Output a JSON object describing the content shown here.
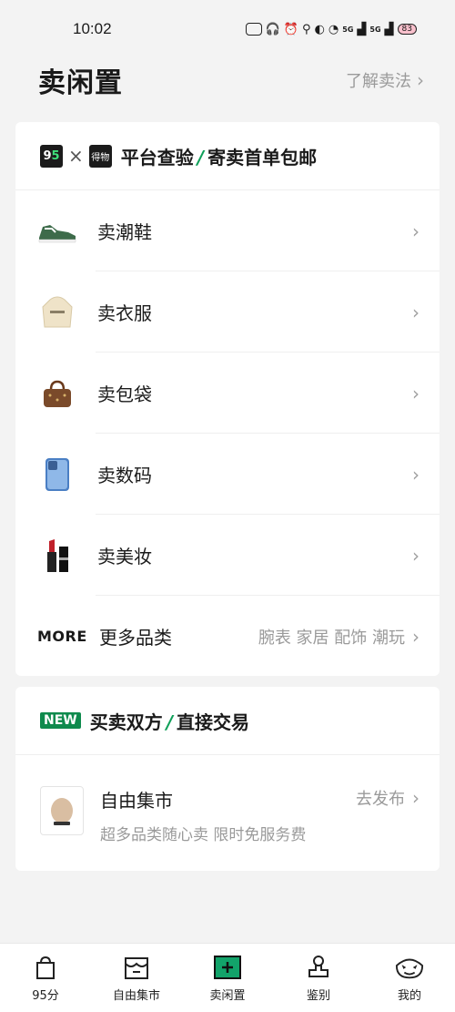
{
  "status": {
    "time": "10:02",
    "battery": "83",
    "signal1": "5G",
    "signal2": "5G"
  },
  "header": {
    "title": "卖闲置",
    "learn_label": "了解卖法"
  },
  "card1": {
    "logo95_a": "9",
    "logo95_b": "5",
    "logo_cross": "×",
    "logo_dw": "得物",
    "headline_a": "平台查验",
    "slash": "/",
    "headline_b": "寄卖首单包邮",
    "items": [
      {
        "label": "卖潮鞋",
        "icon": "sneaker-icon"
      },
      {
        "label": "卖衣服",
        "icon": "hoodie-icon"
      },
      {
        "label": "卖包袋",
        "icon": "handbag-icon"
      },
      {
        "label": "卖数码",
        "icon": "phone-icon"
      },
      {
        "label": "卖美妆",
        "icon": "lipstick-icon"
      }
    ],
    "more": {
      "logo": "MORE",
      "label": "更多品类",
      "hint": "腕表 家居 配饰 潮玩"
    }
  },
  "card2": {
    "badge": "NEW",
    "headline_a": "买卖双方",
    "slash": "/",
    "headline_b": "直接交易",
    "market_title": "自由集市",
    "market_sub": "超多品类随心卖 限时免服务费",
    "market_action": "去发布"
  },
  "tabs": [
    {
      "label": "95分",
      "icon": "bag-check-icon"
    },
    {
      "label": "自由集市",
      "icon": "shop-icon"
    },
    {
      "label": "卖闲置",
      "icon": "sell-plus-icon"
    },
    {
      "label": "鉴别",
      "icon": "stamp-icon"
    },
    {
      "label": "我的",
      "icon": "face-icon"
    }
  ],
  "colors": {
    "accent": "#10a05a",
    "badge": "#0f8a4d",
    "background": "#f3f3f3"
  }
}
